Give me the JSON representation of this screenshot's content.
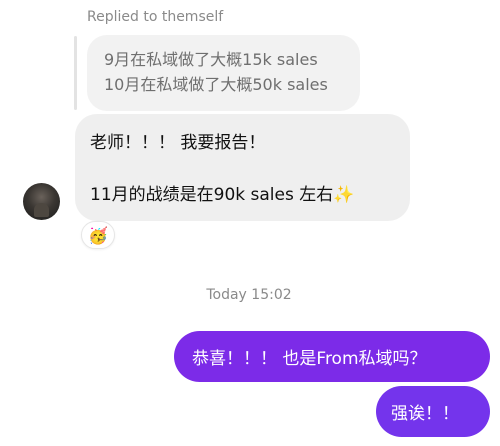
{
  "thread": {
    "reply_label": "Replied to themself",
    "quoted_lines": [
      "9月在私域做了大概15k sales",
      "10月在私域做了大概50k sales"
    ],
    "main_message_lines": [
      "老师！！！ 我要报告！",
      "11月的战绩是在90k sales 左右✨"
    ],
    "reaction_emoji": "🥳",
    "timestamp": "Today 15:02",
    "outgoing": [
      "恭喜！！！ 也是From私域吗？",
      "强诶！！"
    ]
  },
  "colors": {
    "outgoing_bubble": "#7c2be8",
    "incoming_bubble": "#efefef",
    "quoted_bubble": "#f2f2f2",
    "muted_text": "#8a8a8a"
  },
  "icons": {
    "avatar": "user-avatar-photo",
    "reaction": "partying-face-emoji"
  }
}
